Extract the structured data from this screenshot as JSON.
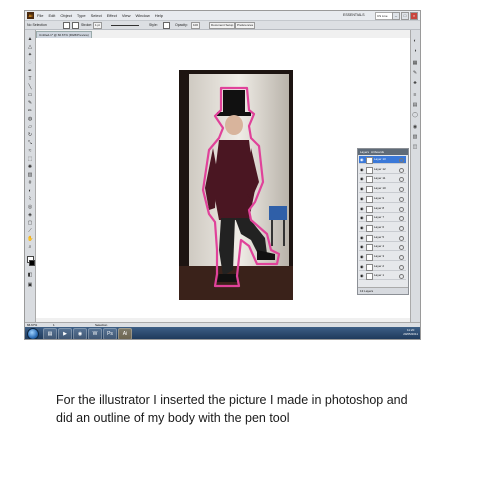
{
  "menubar": {
    "logo": "Ai",
    "items": [
      "File",
      "Edit",
      "Object",
      "Type",
      "Select",
      "Effect",
      "View",
      "Window",
      "Help"
    ],
    "workspace": "ESSENTIALS",
    "search_placeholder": "CS Live"
  },
  "controlbar": {
    "selection": "No Selection",
    "stroke_label": "Stroke:",
    "stroke_value": "1 pt",
    "style_label": "Style:",
    "opacity_label": "Opacity:",
    "opacity_value": "100",
    "doc_setup": "Document Setup",
    "preferences": "Preferences"
  },
  "document": {
    "tab_title": "Untitled-1* @ 66.67% (RGB/Preview)"
  },
  "layers_panel": {
    "tabs": [
      "Layers",
      "Artboards"
    ],
    "rows": [
      "Layer 13",
      "Layer 12",
      "Layer 11",
      "Layer 10",
      "Layer 9",
      "Layer 8",
      "Layer 7",
      "Layer 6",
      "Layer 5",
      "Layer 4",
      "Layer 3",
      "Layer 2",
      "Layer 1"
    ],
    "selected_index": 0,
    "footer": "13 Layers"
  },
  "statusbar": {
    "zoom": "66.67%",
    "page": "1",
    "tool": "Selection"
  },
  "taskbar": {
    "apps": [
      "explorer-icon",
      "media-icon",
      "firefox-icon",
      "word-icon",
      "photoshop-icon",
      "illustrator-icon"
    ],
    "time": "11:20",
    "date": "20/05/2011"
  },
  "caption": "For the illustrator I inserted the picture I made in photoshop and did an outline of my body with the pen tool",
  "colors": {
    "outline": "#e0429a",
    "taskbar": "#2b4a70",
    "selection": "#3a78d8"
  }
}
